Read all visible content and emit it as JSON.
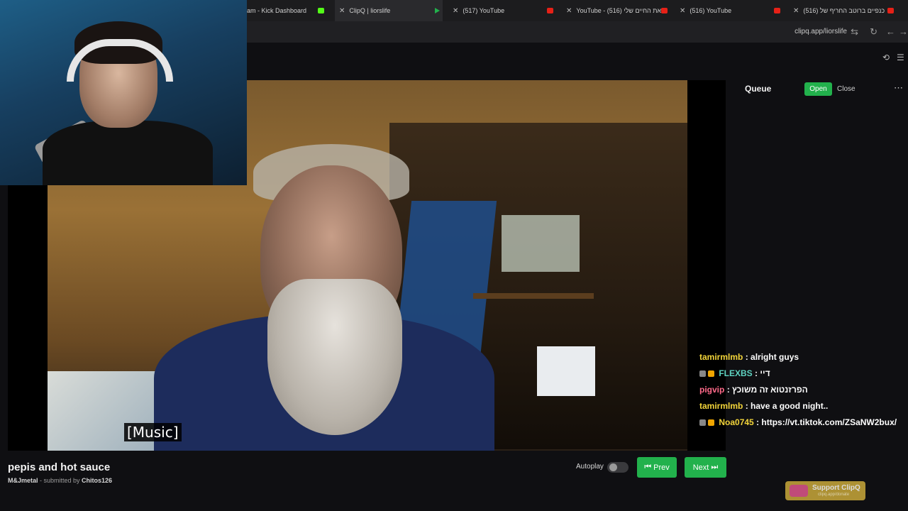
{
  "browser": {
    "tabs": [
      {
        "title": "am - Kick Dashboard",
        "favicon": "kick-icon",
        "active": false
      },
      {
        "title": "ClipQ | liorslife",
        "favicon": "clipq-icon",
        "active": true
      },
      {
        "title": "(517) YouTube",
        "favicon": "youtube-icon",
        "active": false
      },
      {
        "title": "YouTube - את החיים שלי (516)",
        "favicon": "youtube-icon",
        "active": false
      },
      {
        "title": "(516) YouTube",
        "favicon": "youtube-icon",
        "active": false
      },
      {
        "title": "(516) כנפיים ברוטב החריף של",
        "favicon": "youtube-icon",
        "active": false
      }
    ],
    "url": "clipq.app/liorslife"
  },
  "queue": {
    "title": "Queue",
    "open_label": "Open",
    "close_label": "Close"
  },
  "video": {
    "caption": "[Music]"
  },
  "chat": [
    {
      "user": "tamirmlmb",
      "message": ": alright guys",
      "color": "#f2d43a",
      "badges": 0
    },
    {
      "user": "FLEXBS",
      "message": ": דיי",
      "color": "#5fd3c2",
      "badges": 2
    },
    {
      "user": "pigvip",
      "message": ": הפרזנטוא זה משוכץ",
      "color": "#ff6a8a",
      "badges": 0
    },
    {
      "user": "tamirmlmb",
      "message": ": have a good night..",
      "color": "#f2d43a",
      "badges": 0
    },
    {
      "user": "Noa0745",
      "message": ": https://vt.tiktok.com/ZSaNW2bux/",
      "color": "#f2d43a",
      "badges": 2
    }
  ],
  "clip": {
    "title": "pepis and hot sauce",
    "channel": "M&Jmetal",
    "submitted_text": " - submitted by ",
    "submitter": "Chitos126"
  },
  "controls": {
    "autoplay_label": "Autoplay",
    "autoplay_on": false,
    "prev_label": "Prev",
    "next_label": "Next"
  },
  "support": {
    "label": "Support ClipQ",
    "sub": "clipq.app/donate"
  },
  "colors": {
    "accent": "#22b14c",
    "background": "#0f0f12"
  }
}
